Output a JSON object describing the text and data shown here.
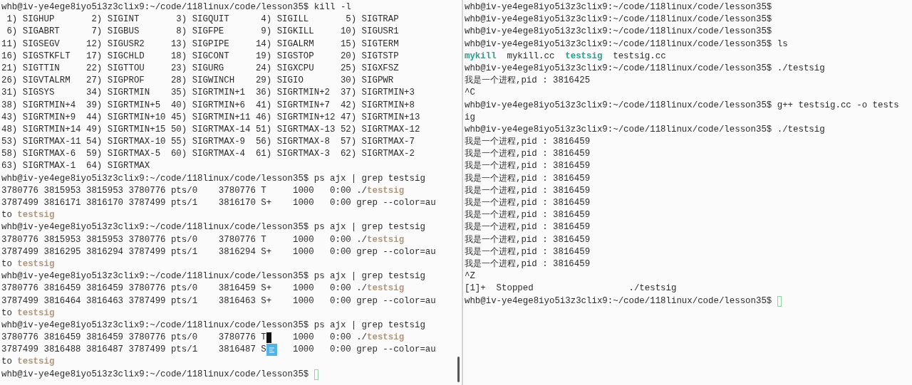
{
  "panes": [
    {
      "scrollbar": true,
      "lines": [
        [
          {
            "kind": "text",
            "text": "whb@iv-ye4ege8iyo5i3z3clix9:~/code/118linux/code/lesson35$ kill -l"
          }
        ],
        [
          {
            "kind": "text",
            "text": " 1) SIGHUP       2) SIGINT       3) SIGQUIT      4) SIGILL       5) SIGTRAP"
          }
        ],
        [
          {
            "kind": "text",
            "text": " 6) SIGABRT      7) SIGBUS       8) SIGFPE       9) SIGKILL     10) SIGUSR1"
          }
        ],
        [
          {
            "kind": "text",
            "text": "11) SIGSEGV     12) SIGUSR2     13) SIGPIPE     14) SIGALRM     15) SIGTERM"
          }
        ],
        [
          {
            "kind": "text",
            "text": "16) SIGSTKFLT   17) SIGCHLD     18) SIGCONT     19) SIGSTOP     20) SIGTSTP"
          }
        ],
        [
          {
            "kind": "text",
            "text": "21) SIGTTIN     22) SIGTTOU     23) SIGURG      24) SIGXCPU     25) SIGXFSZ"
          }
        ],
        [
          {
            "kind": "text",
            "text": "26) SIGVTALRM   27) SIGPROF     28) SIGWINCH    29) SIGIO       30) SIGPWR"
          }
        ],
        [
          {
            "kind": "text",
            "text": "31) SIGSYS      34) SIGRTMIN    35) SIGRTMIN+1  36) SIGRTMIN+2  37) SIGRTMIN+3"
          }
        ],
        [
          {
            "kind": "text",
            "text": "38) SIGRTMIN+4  39) SIGRTMIN+5  40) SIGRTMIN+6  41) SIGRTMIN+7  42) SIGRTMIN+8"
          }
        ],
        [
          {
            "kind": "text",
            "text": "43) SIGRTMIN+9  44) SIGRTMIN+10 45) SIGRTMIN+11 46) SIGRTMIN+12 47) SIGRTMIN+13"
          }
        ],
        [
          {
            "kind": "text",
            "text": "48) SIGRTMIN+14 49) SIGRTMIN+15 50) SIGRTMAX-14 51) SIGRTMAX-13 52) SIGRTMAX-12"
          }
        ],
        [
          {
            "kind": "text",
            "text": "53) SIGRTMAX-11 54) SIGRTMAX-10 55) SIGRTMAX-9  56) SIGRTMAX-8  57) SIGRTMAX-7"
          }
        ],
        [
          {
            "kind": "text",
            "text": "58) SIGRTMAX-6  59) SIGRTMAX-5  60) SIGRTMAX-4  61) SIGRTMAX-3  62) SIGRTMAX-2"
          }
        ],
        [
          {
            "kind": "text",
            "text": "63) SIGRTMAX-1  64) SIGRTMAX"
          }
        ],
        [
          {
            "kind": "text",
            "text": "whb@iv-ye4ege8iyo5i3z3clix9:~/code/118linux/code/lesson35$ ps ajx | grep testsig"
          }
        ],
        [
          {
            "kind": "text",
            "text": "3780776 3815953 3815953 3780776 pts/0    3780776 T     1000   0:00 ./"
          },
          {
            "kind": "match",
            "text": "testsig"
          }
        ],
        [
          {
            "kind": "text",
            "text": "3787499 3816171 3816170 3787499 pts/1    3816170 S+    1000   0:00 grep --color=au"
          }
        ],
        [
          {
            "kind": "text",
            "text": "to "
          },
          {
            "kind": "match",
            "text": "testsig"
          }
        ],
        [
          {
            "kind": "text",
            "text": "whb@iv-ye4ege8iyo5i3z3clix9:~/code/118linux/code/lesson35$ ps ajx | grep testsig"
          }
        ],
        [
          {
            "kind": "text",
            "text": "3780776 3815953 3815953 3780776 pts/0    3780776 T     1000   0:00 ./"
          },
          {
            "kind": "match",
            "text": "testsig"
          }
        ],
        [
          {
            "kind": "text",
            "text": "3787499 3816295 3816294 3787499 pts/1    3816294 S+    1000   0:00 grep --color=au"
          }
        ],
        [
          {
            "kind": "text",
            "text": "to "
          },
          {
            "kind": "match",
            "text": "testsig"
          }
        ],
        [
          {
            "kind": "text",
            "text": "whb@iv-ye4ege8iyo5i3z3clix9:~/code/118linux/code/lesson35$ ps ajx | grep testsig"
          }
        ],
        [
          {
            "kind": "text",
            "text": "3780776 3816459 3816459 3780776 pts/0    3816459 S+    1000   0:00 ./"
          },
          {
            "kind": "match",
            "text": "testsig"
          }
        ],
        [
          {
            "kind": "text",
            "text": "3787499 3816464 3816463 3787499 pts/1    3816463 S+    1000   0:00 grep --color=au"
          }
        ],
        [
          {
            "kind": "text",
            "text": "to "
          },
          {
            "kind": "match",
            "text": "testsig"
          }
        ],
        [
          {
            "kind": "text",
            "text": "whb@iv-ye4ege8iyo5i3z3clix9:~/code/118linux/code/lesson35$ ps ajx | grep testsig"
          }
        ],
        [
          {
            "kind": "text",
            "text": "3780776 3816459 3816459 3780776 pts/0    3780776 T"
          },
          {
            "kind": "block-cursor"
          },
          {
            "kind": "text",
            "text": "    1000   0:00 ./"
          },
          {
            "kind": "match",
            "text": "testsig"
          }
        ],
        [
          {
            "kind": "text",
            "text": "3787499 3816488 3816487 3787499 pts/1    3816487 S"
          },
          {
            "kind": "ime-icon"
          },
          {
            "kind": "text",
            "text": "   1000   0:00 grep --color=au"
          }
        ],
        [
          {
            "kind": "text",
            "text": "to "
          },
          {
            "kind": "match",
            "text": "testsig"
          }
        ],
        [
          {
            "kind": "text",
            "text": "whb@iv-ye4ege8iyo5i3z3clix9:~/code/118linux/code/lesson35$"
          },
          {
            "kind": "hollow-cursor"
          }
        ]
      ]
    },
    {
      "scrollbar": false,
      "lines": [
        [
          {
            "kind": "text",
            "text": "whb@iv-ye4ege8iyo5i3z3clix9:~/code/118linux/code/lesson35$"
          }
        ],
        [
          {
            "kind": "text",
            "text": "whb@iv-ye4ege8iyo5i3z3clix9:~/code/118linux/code/lesson35$"
          }
        ],
        [
          {
            "kind": "text",
            "text": "whb@iv-ye4ege8iyo5i3z3clix9:~/code/118linux/code/lesson35$"
          }
        ],
        [
          {
            "kind": "text",
            "text": "whb@iv-ye4ege8iyo5i3z3clix9:~/code/118linux/code/lesson35$ ls"
          }
        ],
        [
          {
            "kind": "exec",
            "text": "mykill"
          },
          {
            "kind": "text",
            "text": "  mykill.cc  "
          },
          {
            "kind": "exec",
            "text": "testsig"
          },
          {
            "kind": "text",
            "text": "  testsig.cc"
          }
        ],
        [
          {
            "kind": "text",
            "text": "whb@iv-ye4ege8iyo5i3z3clix9:~/code/118linux/code/lesson35$ ./testsig"
          }
        ],
        [
          {
            "kind": "text",
            "text": "我是一个进程,pid : 3816425"
          }
        ],
        [
          {
            "kind": "text",
            "text": "^C"
          }
        ],
        [
          {
            "kind": "text",
            "text": "whb@iv-ye4ege8iyo5i3z3clix9:~/code/118linux/code/lesson35$ g++ testsig.cc -o tests"
          }
        ],
        [
          {
            "kind": "text",
            "text": "ig"
          }
        ],
        [
          {
            "kind": "text",
            "text": "whb@iv-ye4ege8iyo5i3z3clix9:~/code/118linux/code/lesson35$ ./testsig"
          }
        ],
        [
          {
            "kind": "text",
            "text": "我是一个进程,pid : 3816459"
          }
        ],
        [
          {
            "kind": "text",
            "text": "我是一个进程,pid : 3816459"
          }
        ],
        [
          {
            "kind": "text",
            "text": "我是一个进程,pid : 3816459"
          }
        ],
        [
          {
            "kind": "text",
            "text": "我是一个进程,pid : 3816459"
          }
        ],
        [
          {
            "kind": "text",
            "text": "我是一个进程,pid : 3816459"
          }
        ],
        [
          {
            "kind": "text",
            "text": "我是一个进程,pid : 3816459"
          }
        ],
        [
          {
            "kind": "text",
            "text": "我是一个进程,pid : 3816459"
          }
        ],
        [
          {
            "kind": "text",
            "text": "我是一个进程,pid : 3816459"
          }
        ],
        [
          {
            "kind": "text",
            "text": "我是一个进程,pid : 3816459"
          }
        ],
        [
          {
            "kind": "text",
            "text": "我是一个进程,pid : 3816459"
          }
        ],
        [
          {
            "kind": "text",
            "text": "我是一个进程,pid : 3816459"
          }
        ],
        [
          {
            "kind": "text",
            "text": "^Z"
          }
        ],
        [
          {
            "kind": "text",
            "text": "[1]+  Stopped                  ./testsig"
          }
        ],
        [
          {
            "kind": "text",
            "text": "whb@iv-ye4ege8iyo5i3z3clix9:~/code/118linux/code/lesson35$"
          },
          {
            "kind": "hollow-cursor"
          }
        ]
      ]
    }
  ]
}
